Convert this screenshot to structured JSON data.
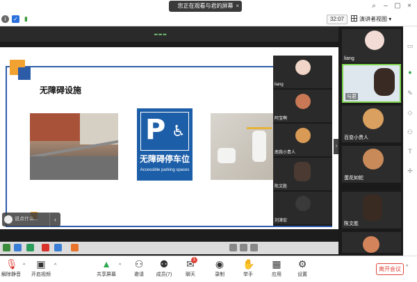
{
  "window": {
    "title": "您正在观看与君的屏幕",
    "close_glyph": "×"
  },
  "toolbar": {
    "timer": "32:07",
    "view_mode": "演讲者视图"
  },
  "slide": {
    "title": "无障碍设施",
    "sign_cn": "无障碍停车位",
    "sign_en": "Accessible parking spaces",
    "sign_letter": "P",
    "sign_symbol": "♿"
  },
  "chat_bubble": {
    "placeholder": "说点什么..."
  },
  "share_strip": [
    {
      "name": "liang"
    },
    {
      "name": "阿宝啊"
    },
    {
      "name": "南我小贵人"
    },
    {
      "name": "陈文胜"
    },
    {
      "name": "刘津宏"
    }
  ],
  "gallery": [
    {
      "name": "liang"
    },
    {
      "name": "与君",
      "active": true
    },
    {
      "name": "百变小贵人"
    },
    {
      "name": "蛋花如蛇"
    },
    {
      "name": "陈文胜"
    }
  ],
  "controls": [
    {
      "label": "解除静音",
      "icon": "microphone-muted-icon"
    },
    {
      "label": "开启视频",
      "icon": "video-off-icon"
    },
    {
      "label": "共享屏幕",
      "icon": "share-screen-icon"
    },
    {
      "label": "邀请",
      "icon": "invite-icon"
    },
    {
      "label": "成员(7)",
      "icon": "participants-icon"
    },
    {
      "label": "聊天",
      "icon": "chat-icon"
    },
    {
      "label": "录制",
      "icon": "record-icon"
    },
    {
      "label": "举手",
      "icon": "raise-hand-icon"
    },
    {
      "label": "应用",
      "icon": "apps-icon"
    },
    {
      "label": "设置",
      "icon": "settings-icon"
    }
  ],
  "chat_badge": "1",
  "leave_label": "离开会议",
  "colors": {
    "accent_green": "#7bd24a",
    "leave_red": "#e0443a",
    "slide_blue": "#2c5ba8"
  }
}
